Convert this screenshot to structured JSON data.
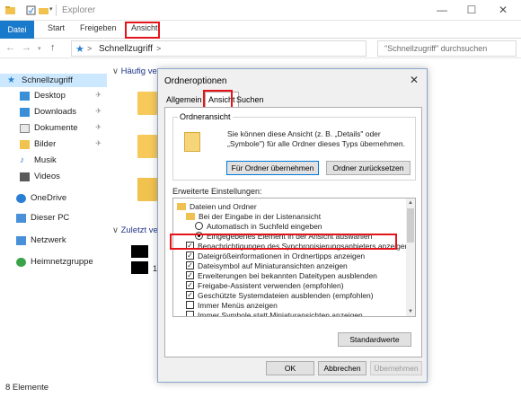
{
  "explorer": {
    "title": "Explorer",
    "window_buttons": {
      "minimize": "—",
      "maximize": "☐",
      "close": "✕"
    },
    "ribbon_tabs": [
      "Datei",
      "Start",
      "Freigeben",
      "Ansicht"
    ],
    "address": "Schnellzugriff",
    "address_chevron": ">",
    "search_placeholder": "\"Schnellzugriff\" durchsuchen",
    "sidebar": {
      "quick_access": "Schnellzugriff",
      "items": [
        "Desktop",
        "Downloads",
        "Dokumente",
        "Bilder",
        "Musik",
        "Videos"
      ],
      "onedrive": "OneDrive",
      "this_pc": "Dieser PC",
      "network": "Netzwerk",
      "homegroup": "Heimnetzgruppe"
    },
    "content": {
      "frequent_header": "Häufig ve",
      "recent_header": "Zuletzt ve",
      "recent_digit": "1"
    },
    "status": "8 Elemente"
  },
  "dialog": {
    "title": "Ordneroptionen",
    "close": "✕",
    "tabs": [
      "Allgemein",
      "Ansicht",
      "Suchen"
    ],
    "folder_view_legend": "Ordneransicht",
    "folder_view_text": "Sie können diese Ansicht (z. B. „Details\" oder „Symbole\") für alle Ordner dieses Typs übernehmen.",
    "apply_button": "Für Ordner übernehmen",
    "reset_button": "Ordner zurücksetzen",
    "advanced_label": "Erweiterte Einstellungen:",
    "advanced_rows": [
      {
        "type": "folder",
        "label": "Dateien und Ordner",
        "indent": 0
      },
      {
        "type": "folder",
        "label": "Bei der Eingabe in der Listenansicht",
        "indent": 1
      },
      {
        "type": "radio",
        "checked": false,
        "label": "Automatisch in Suchfeld eingeben",
        "indent": 2
      },
      {
        "type": "radio",
        "checked": true,
        "label": "Eingegebenes Element in der Ansicht auswählen",
        "indent": 2
      },
      {
        "type": "check",
        "checked": true,
        "label": "Benachrichtigungen des Synchronisierungsanbieters anzeigen",
        "indent": 1
      },
      {
        "type": "check",
        "checked": true,
        "label": "Dateigrößeinformationen in Ordnertipps anzeigen",
        "indent": 1
      },
      {
        "type": "check",
        "checked": true,
        "label": "Dateisymbol auf Miniaturansichten anzeigen",
        "indent": 1
      },
      {
        "type": "check",
        "checked": true,
        "label": "Erweiterungen bei bekannten Dateitypen ausblenden",
        "indent": 1
      },
      {
        "type": "check",
        "checked": true,
        "label": "Freigabe-Assistent verwenden (empfohlen)",
        "indent": 1
      },
      {
        "type": "check",
        "checked": true,
        "label": "Geschützte Systemdateien ausblenden (empfohlen)",
        "indent": 1
      },
      {
        "type": "check",
        "checked": false,
        "label": "Immer Menüs anzeigen",
        "indent": 1
      },
      {
        "type": "check",
        "checked": false,
        "label": "Immer Symbole statt Miniaturansichten anzeigen",
        "indent": 1
      }
    ],
    "defaults_button": "Standardwerte",
    "ok_button": "OK",
    "cancel_button": "Abbrechen",
    "apply_disabled_button": "Übernehmen"
  },
  "colors": {
    "highlight": "#e4141b",
    "accent": "#1979ca"
  }
}
